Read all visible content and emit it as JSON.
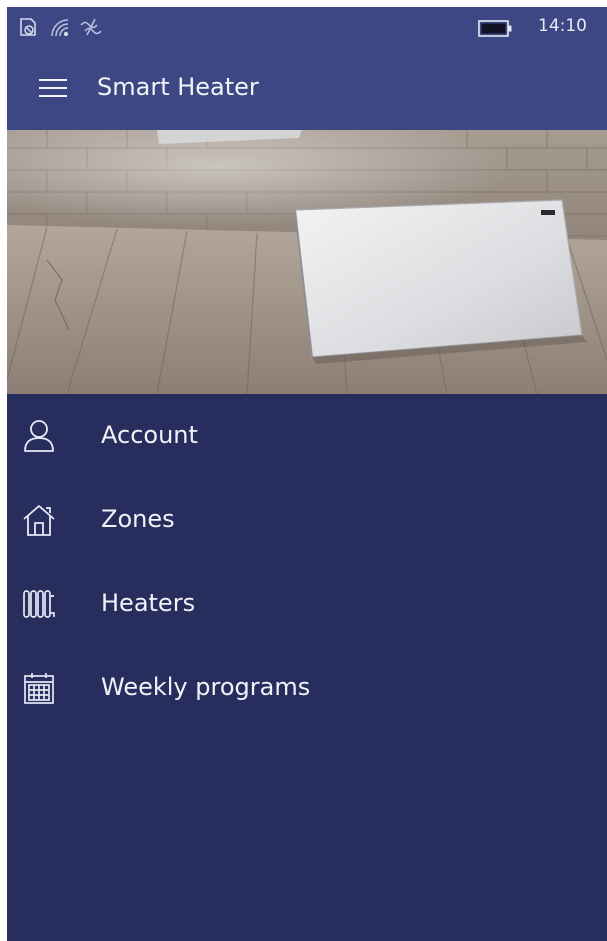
{
  "status_bar": {
    "time": "14:10",
    "icons": [
      "notification-icon",
      "wifi-icon",
      "connection-icon",
      "battery-icon"
    ]
  },
  "header": {
    "title": "Smart Heater",
    "menu_icon": "hamburger-icon"
  },
  "menu": {
    "items": [
      {
        "label": "Account",
        "icon": "account-icon"
      },
      {
        "label": "Zones",
        "icon": "home-icon"
      },
      {
        "label": "Heaters",
        "icon": "radiator-icon"
      },
      {
        "label": "Weekly programs",
        "icon": "calendar-icon"
      }
    ]
  },
  "colors": {
    "header_background": "#3c4783",
    "menu_background": "#272d5c",
    "text": "#f2f3f8"
  }
}
